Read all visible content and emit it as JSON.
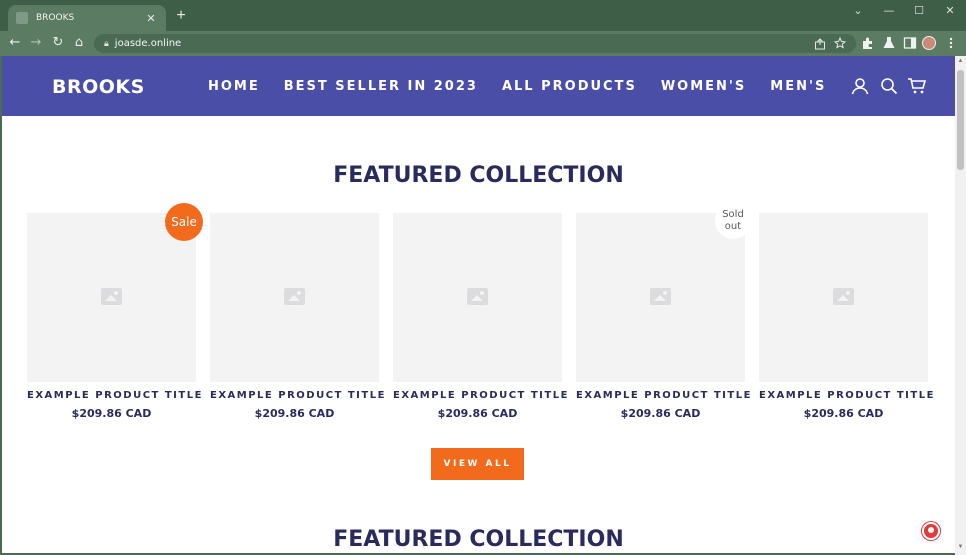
{
  "browser": {
    "tab_title": "BROOKS",
    "tab_close": "✕",
    "new_tab": "+",
    "url": "joasde.online",
    "window_controls": {
      "chevron": "⌄",
      "minimize": "—",
      "maximize": "☐",
      "close": "✕"
    },
    "nav": {
      "back": "←",
      "forward": "→",
      "reload": "↻",
      "home": "⌂"
    }
  },
  "site": {
    "logo": "BROOKS",
    "nav": [
      "HOME",
      "BEST SELLER IN 2023",
      "ALL PRODUCTS",
      "WOMEN'S",
      "MEN'S"
    ],
    "header_icons": [
      "account-icon",
      "search-icon",
      "cart-icon"
    ]
  },
  "main": {
    "section_title": "FEATURED COLLECTION",
    "products": [
      {
        "title": "EXAMPLE PRODUCT TITLE",
        "price": "$209.86 CAD",
        "badge": "Sale"
      },
      {
        "title": "EXAMPLE PRODUCT TITLE",
        "price": "$209.86 CAD",
        "badge": ""
      },
      {
        "title": "EXAMPLE PRODUCT TITLE",
        "price": "$209.86 CAD",
        "badge": ""
      },
      {
        "title": "EXAMPLE PRODUCT TITLE",
        "price": "$209.86 CAD",
        "badge": "Sold out"
      },
      {
        "title": "EXAMPLE PRODUCT TITLE",
        "price": "$209.86 CAD",
        "badge": ""
      }
    ],
    "view_all": "VIEW ALL",
    "second_section_title": "FEATURED COLLECTION"
  },
  "colors": {
    "header_bg": "#4a4ea6",
    "accent": "#f26a1b",
    "title_text": "#2b2a5d",
    "browser_frame": "#5b7b63"
  }
}
